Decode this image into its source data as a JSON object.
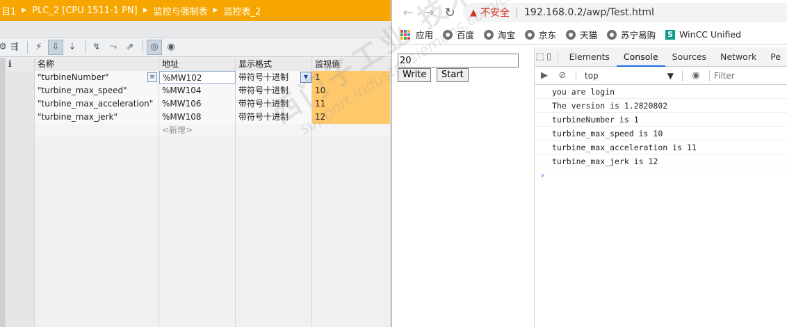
{
  "tia": {
    "title_path": [
      "目1",
      "PLC_2 [CPU 1511-1 PN]",
      "监控与强制表",
      "监控表_2"
    ],
    "columns": {
      "info": "i",
      "name": "名称",
      "address": "地址",
      "format": "显示格式",
      "monitor": "监视值"
    },
    "rows": [
      {
        "name": "\"turbineNumber\"",
        "address": "%MW102",
        "format": "带符号十进制",
        "value": "1"
      },
      {
        "name": "\"turbine_max_speed\"",
        "address": "%MW104",
        "format": "带符号十进制",
        "value": "10"
      },
      {
        "name": "\"turbine_max_acceleration\"",
        "address": "%MW106",
        "format": "带符号十进制",
        "value": "11"
      },
      {
        "name": "\"turbine_max_jerk\"",
        "address": "%MW108",
        "format": "带符号十进制",
        "value": "12"
      }
    ],
    "new_row_label": "<新增>"
  },
  "browser": {
    "not_secure": "不安全",
    "url": "192.168.0.2/awp/Test.html",
    "bookmarks": [
      {
        "label": "应用",
        "icon": "apps-grid-icon"
      },
      {
        "label": "百度",
        "icon": "globe-icon"
      },
      {
        "label": "淘宝",
        "icon": "globe-icon"
      },
      {
        "label": "京东",
        "icon": "globe-icon"
      },
      {
        "label": "天猫",
        "icon": "globe-icon"
      },
      {
        "label": "苏宁易购",
        "icon": "globe-icon"
      },
      {
        "label": "WinCC Unified",
        "icon": "wincc-icon"
      }
    ],
    "page": {
      "input_value": "20",
      "write_label": "Write",
      "start_label": "Start"
    },
    "devtools": {
      "tabs": [
        "Elements",
        "Console",
        "Sources",
        "Network",
        "Pe"
      ],
      "active_tab": "Console",
      "context": "top",
      "filter_placeholder": "Filter",
      "log": [
        "you are login",
        "The version is 1.2820802",
        "turbineNumber is 1",
        "turbine_max_speed is 10",
        "turbine_max_acceleration is 11",
        "turbine_max_jerk is 12"
      ],
      "prompt": "›"
    }
  },
  "watermark": {
    "cn": "西门子工业 技术论坛",
    "url": "support.industry.siemens.com/cs"
  },
  "colors": {
    "tia_title": "#f7a600",
    "monitor_cell": "#ffc96b",
    "not_secure": "#d93025",
    "devtools_accent": "#1a73e8"
  }
}
